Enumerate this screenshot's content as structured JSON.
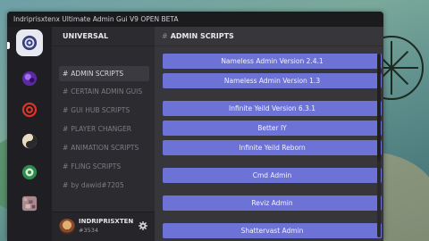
{
  "window": {
    "title": "Indriprisxtenx Ultimate Admin Gui V9 OPEN BETA"
  },
  "rail": {
    "items": [
      {
        "icon": "script-hub-icon",
        "color": "#7a8ad8",
        "active": true
      },
      {
        "icon": "purple-orb-icon",
        "color": "#7a3ec2",
        "active": false
      },
      {
        "icon": "red-swirl-icon",
        "color": "#d8342a",
        "active": false
      },
      {
        "icon": "yin-yang-icon",
        "color": "#e6d8b0",
        "active": false
      },
      {
        "icon": "green-orb-icon",
        "color": "#3aa560",
        "active": false
      },
      {
        "icon": "noise-tile-icon",
        "color": "#b08a8a",
        "active": false
      }
    ]
  },
  "sidebar": {
    "header": "UNIVERSAL",
    "items": [
      {
        "label": "ADMIN SCRIPTS",
        "active": true
      },
      {
        "label": "CERTAIN ADMIN GUIS",
        "active": false
      },
      {
        "label": "GUI HUB SCRIPTS",
        "active": false
      },
      {
        "label": "PLAYER CHANGER",
        "active": false
      },
      {
        "label": "ANIMATION SCRIPTS",
        "active": false
      },
      {
        "label": "FLING SCRIPTS",
        "active": false
      },
      {
        "label": "by dawid#7205",
        "active": false
      }
    ],
    "hash": "#"
  },
  "profile": {
    "name": "INDRIPRISXTEN",
    "tag": "#3534"
  },
  "main": {
    "header": "ADMIN SCRIPTS",
    "buttons": [
      "Nameless Admin Version 2.4.1",
      "Nameless Admin Version 1.3",
      "Infinite Yeild Version 6.3.1",
      "Better IY",
      "Infinite Yeild Reborn",
      "Cmd Admin",
      "Reviz Admin",
      "Shattervast Admin"
    ]
  },
  "colors": {
    "accent": "#6c72d6"
  }
}
